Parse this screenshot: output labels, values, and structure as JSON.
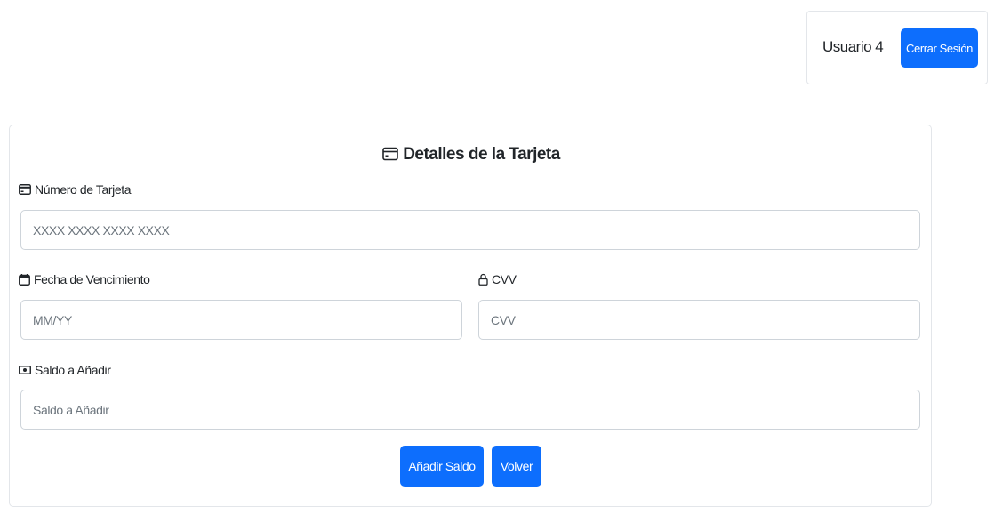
{
  "header": {
    "user_name": "Usuario 4",
    "logout_label": "Cerrar Sesión"
  },
  "card": {
    "title": "Detalles de la Tarjeta",
    "title_icon": "credit-card-icon"
  },
  "form": {
    "card_number": {
      "label": "Número de Tarjeta",
      "icon": "credit-card-icon",
      "placeholder": "XXXX XXXX XXXX XXXX",
      "value": ""
    },
    "expiry": {
      "label": "Fecha de Vencimiento",
      "icon": "calendar-icon",
      "placeholder": "MM/YY",
      "value": ""
    },
    "cvv": {
      "label": "CVV",
      "icon": "lock-icon",
      "placeholder": "CVV",
      "value": ""
    },
    "balance": {
      "label": "Saldo a Añadir",
      "icon": "cash-icon",
      "placeholder": "Saldo a Añadir",
      "value": ""
    }
  },
  "actions": {
    "add_balance_label": "Añadir Saldo",
    "back_label": "Volver"
  },
  "colors": {
    "primary": "#0d6efd",
    "border": "#ced4da"
  }
}
